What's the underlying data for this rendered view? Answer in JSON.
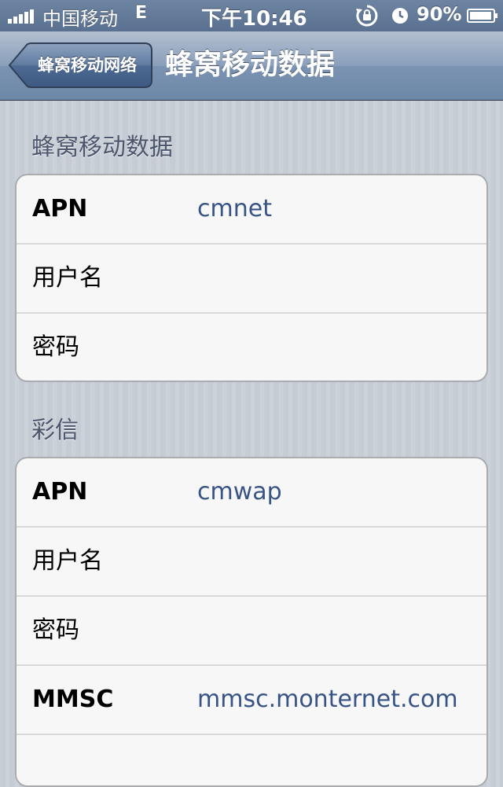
{
  "status_bar": {
    "carrier": "中国移动",
    "network": "E",
    "time": "下午10:46",
    "battery": "90%"
  },
  "nav": {
    "back_label": "蜂窝移动网络",
    "title": "蜂窝移动数据"
  },
  "sections": [
    {
      "header": "蜂窝移动数据",
      "rows": [
        {
          "label": "APN",
          "value": "cmnet"
        },
        {
          "label": "用户名",
          "value": ""
        },
        {
          "label": "密码",
          "value": ""
        }
      ]
    },
    {
      "header": "彩信",
      "rows": [
        {
          "label": "APN",
          "value": "cmwap"
        },
        {
          "label": "用户名",
          "value": ""
        },
        {
          "label": "密码",
          "value": ""
        },
        {
          "label": "MMSC",
          "value": "mmsc.monternet.com"
        },
        {
          "label": "",
          "value": ""
        }
      ]
    }
  ],
  "colors": {
    "nav_blue": "#6d87a8",
    "value_blue": "#385487",
    "section_text": "#4c566c"
  },
  "icons": [
    "signal-bars-icon",
    "rotation-lock-icon",
    "alarm-icon",
    "battery-icon"
  ]
}
